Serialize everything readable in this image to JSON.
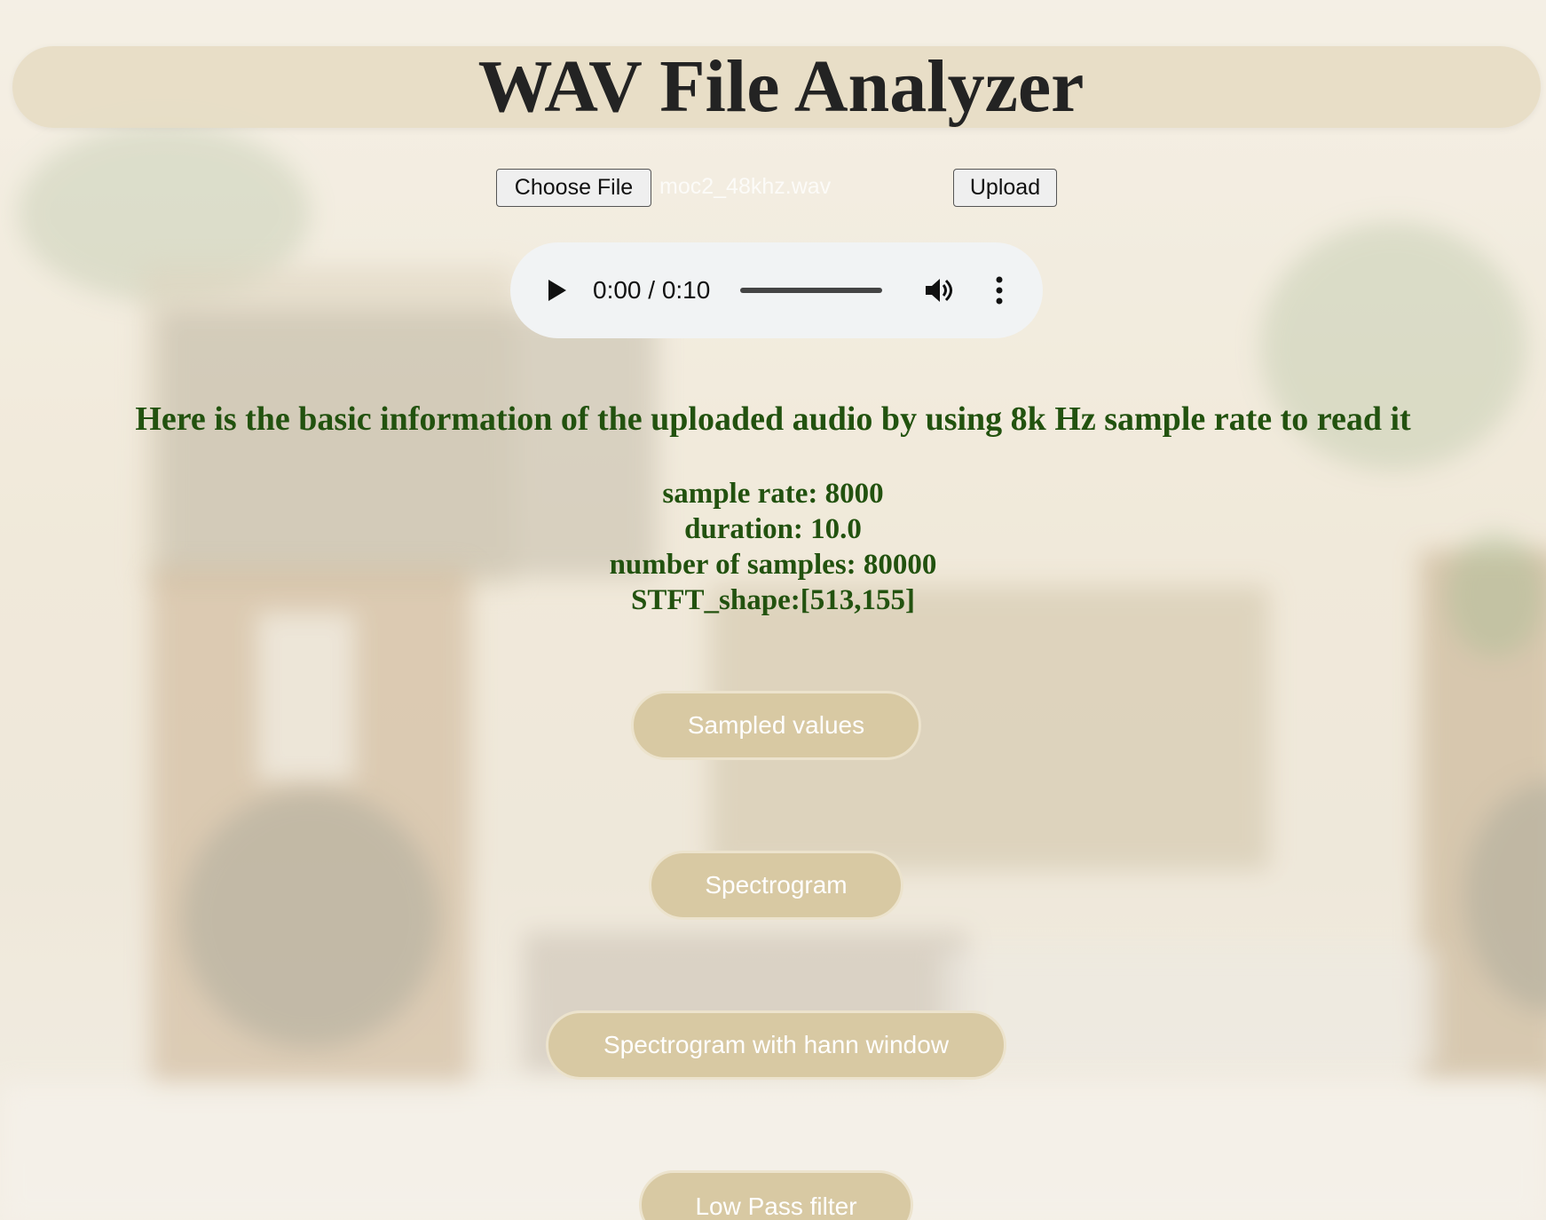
{
  "header": {
    "title": "WAV File Analyzer"
  },
  "upload": {
    "choose_file_label": "Choose File",
    "file_name": "moc2_48khz.wav",
    "upload_label": "Upload"
  },
  "audio": {
    "time": "0:00 / 0:10",
    "progress": 0
  },
  "info": {
    "heading": "Here is the basic information of the uploaded audio by using 8k Hz sample rate to read it",
    "sample_rate": "sample rate: 8000",
    "duration": "duration: 10.0",
    "num_samples": "number of samples: 80000",
    "stft_shape": "STFT_shape:[513,155]"
  },
  "actions": {
    "sampled_values": "Sampled values",
    "spectrogram": "Spectrogram",
    "spectrogram_hann": "Spectrogram with hann window",
    "low_pass": "Low Pass filter"
  },
  "colors": {
    "title_bar": "#e6dcc4",
    "info_text": "#22520f",
    "button_fill": "#d8c9a3",
    "button_text": "#ffffff"
  },
  "icons": {
    "play": "play-icon",
    "volume": "volume-icon",
    "more": "more-vertical-icon"
  }
}
